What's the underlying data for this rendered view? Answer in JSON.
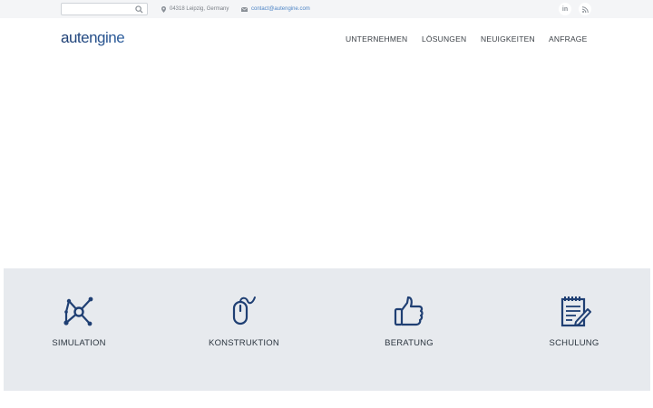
{
  "topbar": {
    "search": {
      "placeholder": "",
      "value": "",
      "icon": "search-icon"
    },
    "address": "04318 Leipzig, Germany",
    "email": "contact@autengine.com",
    "social": [
      {
        "name": "linkedin-icon",
        "label": "in"
      },
      {
        "name": "rss-icon",
        "label": "rss"
      }
    ]
  },
  "header": {
    "logo_text": "autengine",
    "nav": [
      "UNTERNEHMEN",
      "LÖSUNGEN",
      "NEUIGKEITEN",
      "ANFRAGE"
    ]
  },
  "services": [
    {
      "label": "SIMULATION",
      "icon": "network-nodes-icon"
    },
    {
      "label": "KONSTRUKTION",
      "icon": "mouse-icon"
    },
    {
      "label": "BERATUNG",
      "icon": "thumbs-up-icon"
    },
    {
      "label": "SCHULUNG",
      "icon": "notepad-pencil-icon"
    }
  ],
  "colors": {
    "accent": "#1f3f73",
    "link": "#4f86c6",
    "topbar_bg": "#f4f5f7",
    "services_bg": "#e7eaee"
  }
}
